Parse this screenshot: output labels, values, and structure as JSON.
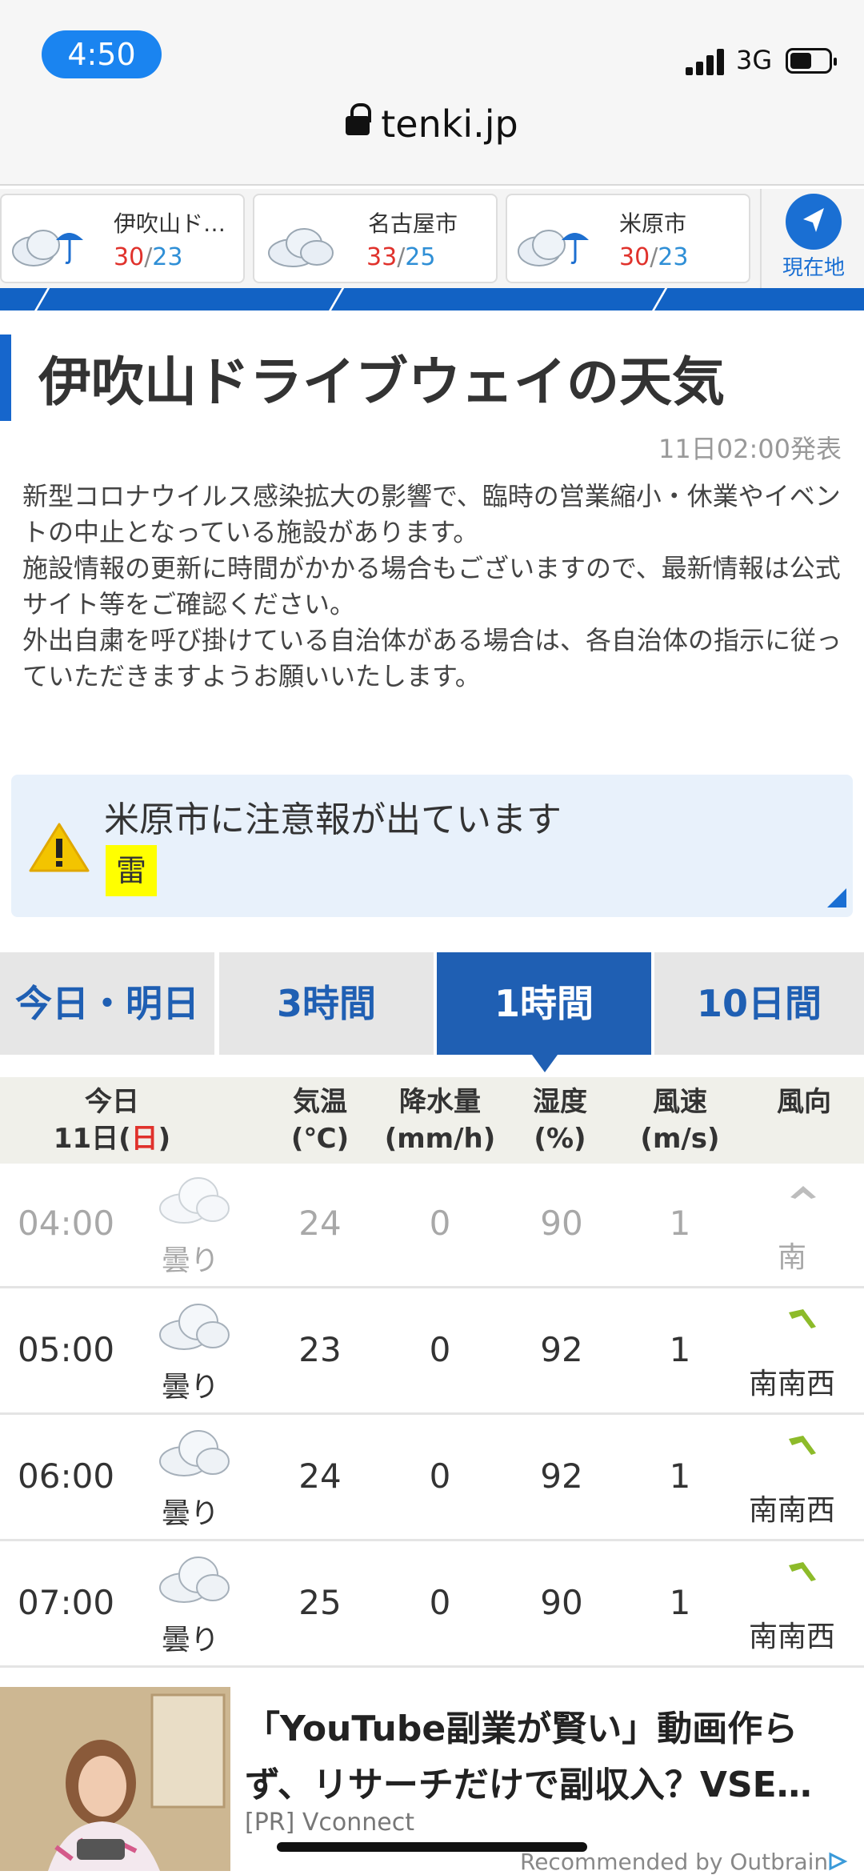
{
  "status_bar": {
    "time": "4:50",
    "network": "3G"
  },
  "browser": {
    "url": "tenki.jp"
  },
  "locations": [
    {
      "name": "伊吹山ド…",
      "high": "30",
      "low": "23",
      "icon": "cloud-umbrella-icon"
    },
    {
      "name": "名古屋市",
      "high": "33",
      "low": "25",
      "icon": "cloud-icon"
    },
    {
      "name": "米原市",
      "high": "30",
      "low": "23",
      "icon": "cloud-umbrella-icon"
    }
  ],
  "current_location_label": "現在地",
  "page": {
    "title": "伊吹山ドライブウェイの天気",
    "published": "11日02:00発表",
    "notice": [
      "新型コロナウイルス感染拡大の影響で、臨時の営業縮小・休業やイベントの中止となっている施設があります。",
      "施設情報の更新に時間がかかる場合もございますので、最新情報は公式サイト等をご確認ください。",
      "外出自粛を呼び掛けている自治体がある場合は、各自治体の指示に従っていただきますようお願いいたします。"
    ]
  },
  "warning": {
    "title": "米原市に注意報が出ています",
    "badge": "雷",
    "badge_color": "#ffff00"
  },
  "tabs": [
    {
      "label": "今日・明日",
      "active": false
    },
    {
      "label": "3時間",
      "active": false
    },
    {
      "label": "1時間",
      "active": true
    },
    {
      "label": "10日間",
      "active": false
    }
  ],
  "table": {
    "headers": {
      "day_label": "今日",
      "date_prefix": "11日(",
      "date_weekday": "日",
      "date_suffix": ")",
      "temp": "気温",
      "temp_unit": "(℃)",
      "precip": "降水量",
      "precip_unit": "(mm/h)",
      "humidity": "湿度",
      "humidity_unit": "(%)",
      "wind_speed": "風速",
      "wind_speed_unit": "(m/s)",
      "wind_dir": "風向"
    },
    "rows": [
      {
        "time": "04:00",
        "weather": "曇り",
        "temp": "24",
        "precip": "0",
        "humidity": "90",
        "wind_speed": "1",
        "wind_dir": "南",
        "past": true
      },
      {
        "time": "05:00",
        "weather": "曇り",
        "temp": "23",
        "precip": "0",
        "humidity": "92",
        "wind_speed": "1",
        "wind_dir": "南南西",
        "past": false
      },
      {
        "time": "06:00",
        "weather": "曇り",
        "temp": "24",
        "precip": "0",
        "humidity": "92",
        "wind_speed": "1",
        "wind_dir": "南南西",
        "past": false
      },
      {
        "time": "07:00",
        "weather": "曇り",
        "temp": "25",
        "precip": "0",
        "humidity": "90",
        "wind_speed": "1",
        "wind_dir": "南南西",
        "past": false
      }
    ]
  },
  "ad": {
    "title": "「YouTube副業が賢い」動画作らず、リサーチだけで副収入？VSE…",
    "source": "[PR] Vconnect",
    "recommended": "Recommended by Outbrain"
  },
  "colors": {
    "accent": "#1f5fb3",
    "high_temp": "#e0322c",
    "low_temp": "#2f8fd6",
    "wind_arrow": "#8dbb2a"
  }
}
